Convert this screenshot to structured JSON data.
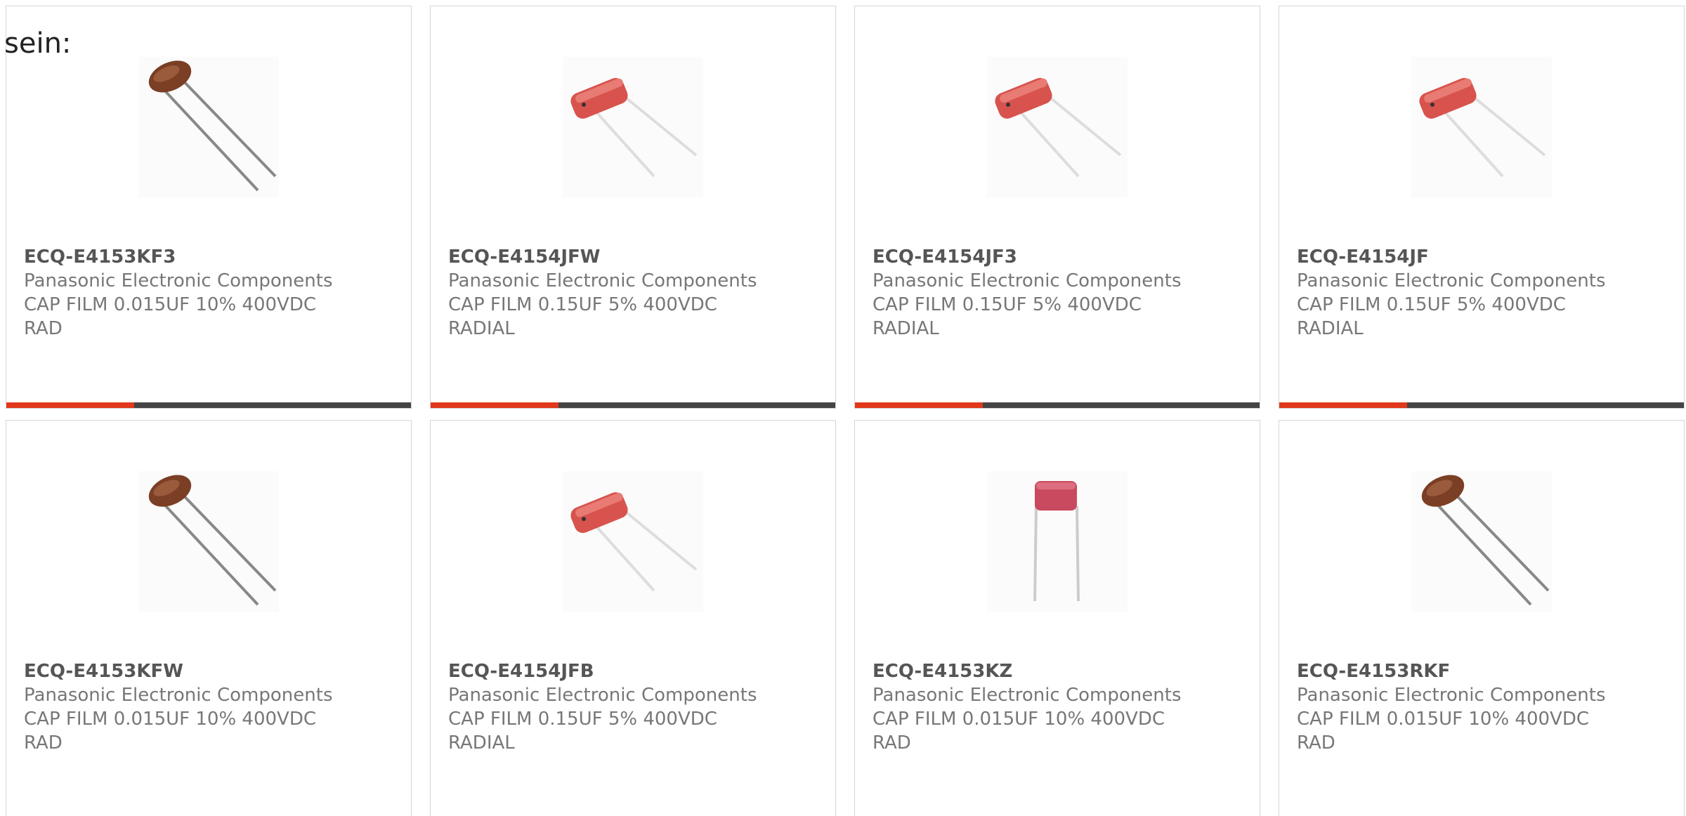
{
  "intro_text": "sein:",
  "accent_color": "#e1381b",
  "bar_color": "#444444",
  "products": [
    {
      "part_number": "ECQ-E4153KF3",
      "manufacturer": "Panasonic Electronic Components",
      "description": "CAP FILM 0.015UF 10% 400VDC\nRAD",
      "image": "brown-film-capacitor-icon"
    },
    {
      "part_number": "ECQ-E4154JFW",
      "manufacturer": "Panasonic Electronic Components",
      "description": "CAP FILM 0.15UF 5% 400VDC\nRADIAL",
      "image": "red-film-capacitor-icon"
    },
    {
      "part_number": "ECQ-E4154JF3",
      "manufacturer": "Panasonic Electronic Components",
      "description": "CAP FILM 0.15UF 5% 400VDC\nRADIAL",
      "image": "red-film-capacitor-icon"
    },
    {
      "part_number": "ECQ-E4154JF",
      "manufacturer": "Panasonic Electronic Components",
      "description": "CAP FILM 0.15UF 5% 400VDC\nRADIAL",
      "image": "red-film-capacitor-icon"
    },
    {
      "part_number": "ECQ-E4153KFW",
      "manufacturer": "Panasonic Electronic Components",
      "description": "CAP FILM 0.015UF 10% 400VDC\nRAD",
      "image": "brown-film-capacitor-icon"
    },
    {
      "part_number": "ECQ-E4154JFB",
      "manufacturer": "Panasonic Electronic Components",
      "description": "CAP FILM 0.15UF 5% 400VDC\nRADIAL",
      "image": "red-film-capacitor-icon"
    },
    {
      "part_number": "ECQ-E4153KZ",
      "manufacturer": "Panasonic Electronic Components",
      "description": "CAP FILM 0.015UF 10% 400VDC\nRAD",
      "image": "upright-film-capacitor-icon"
    },
    {
      "part_number": "ECQ-E4153RKF",
      "manufacturer": "Panasonic Electronic Components",
      "description": "CAP FILM 0.015UF 10% 400VDC\nRAD",
      "image": "brown-film-capacitor-icon"
    }
  ]
}
